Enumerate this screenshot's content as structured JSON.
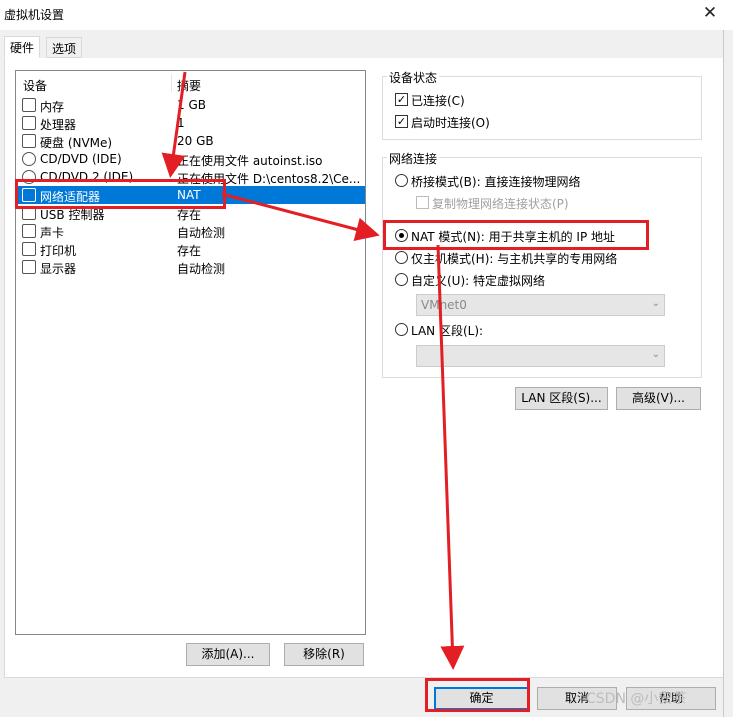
{
  "window": {
    "title": "虚拟机设置",
    "close_glyph": "✕"
  },
  "tabs": [
    {
      "label": "硬件",
      "active": true
    },
    {
      "label": "选项",
      "active": false
    }
  ],
  "devices": {
    "headers": {
      "device": "设备",
      "summary": "摘要"
    },
    "rows": [
      {
        "icon": "memory-icon",
        "name": "内存",
        "summary": "1 GB"
      },
      {
        "icon": "processor-icon",
        "name": "处理器",
        "summary": "1"
      },
      {
        "icon": "hard-disk-icon",
        "name": "硬盘 (NVMe)",
        "summary": "20 GB"
      },
      {
        "icon": "cd-dvd-icon",
        "name": "CD/DVD (IDE)",
        "summary": "正在使用文件 autoinst.iso"
      },
      {
        "icon": "cd-dvd-icon",
        "name": "CD/DVD 2 (IDE)",
        "summary": "正在使用文件 D:\\centos8.2\\Ce..."
      },
      {
        "icon": "network-adapter-icon",
        "name": "网络适配器",
        "summary": "NAT",
        "selected": true
      },
      {
        "icon": "usb-controller-icon",
        "name": "USB 控制器",
        "summary": "存在"
      },
      {
        "icon": "sound-card-icon",
        "name": "声卡",
        "summary": "自动检测"
      },
      {
        "icon": "printer-icon",
        "name": "打印机",
        "summary": "存在"
      },
      {
        "icon": "display-icon",
        "name": "显示器",
        "summary": "自动检测"
      }
    ],
    "add_button": "添加(A)...",
    "remove_button": "移除(R)"
  },
  "device_status": {
    "title": "设备状态",
    "connected": {
      "label": "已连接(C)",
      "checked": true
    },
    "connect_on_power_on": {
      "label": "启动时连接(O)",
      "checked": true
    }
  },
  "network_connection": {
    "title": "网络连接",
    "bridged": {
      "label": "桥接模式(B): 直接连接物理网络",
      "selected": false
    },
    "replicate_state": {
      "label": "复制物理网络连接状态(P)",
      "checked": false,
      "enabled": false
    },
    "nat": {
      "label": "NAT 模式(N): 用于共享主机的 IP 地址",
      "selected": true
    },
    "host_only": {
      "label": "仅主机模式(H): 与主机共享的专用网络",
      "selected": false
    },
    "custom": {
      "label": "自定义(U): 特定虚拟网络",
      "selected": false
    },
    "custom_network_value": "VMnet0",
    "lan_segment": {
      "label": "LAN 区段(L):",
      "selected": false
    },
    "lan_segment_value": "",
    "lan_segments_button": "LAN 区段(S)...",
    "advanced_button": "高级(V)..."
  },
  "footer": {
    "ok_button": "确定",
    "cancel_button": "取消",
    "help_button": "帮助"
  },
  "watermark": "CSDN @小安茶",
  "colors": {
    "selection": "#0078d7",
    "annotation": "#e31e24"
  }
}
